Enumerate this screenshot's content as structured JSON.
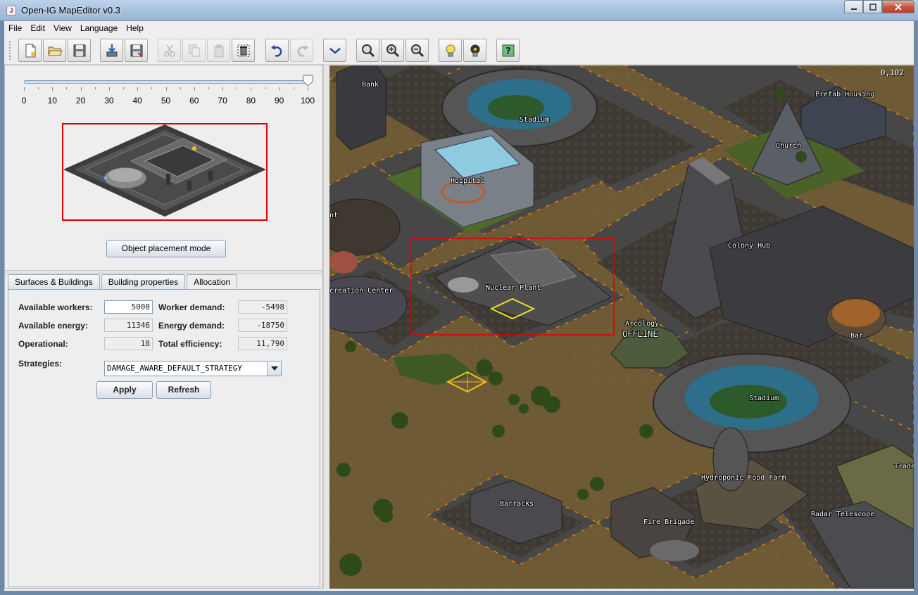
{
  "window": {
    "title": "Open-IG MapEditor v0.3",
    "app_icon": "java-cup-icon"
  },
  "menu": [
    "File",
    "Edit",
    "View",
    "Language",
    "Help"
  ],
  "toolbar": {
    "buttons": [
      {
        "name": "new-map-button",
        "icon": "new-document-icon",
        "enabled": true
      },
      {
        "name": "open-button",
        "icon": "open-folder-icon",
        "enabled": true
      },
      {
        "name": "save-button",
        "icon": "floppy-disk-icon",
        "enabled": true
      },
      {
        "name": "import-button",
        "icon": "import-download-icon",
        "enabled": true
      },
      {
        "name": "save-as-button",
        "icon": "save-as-icon",
        "enabled": true
      },
      {
        "name": "cut-button",
        "icon": "scissors-icon",
        "enabled": false
      },
      {
        "name": "copy-button",
        "icon": "copy-icon",
        "enabled": false
      },
      {
        "name": "paste-button",
        "icon": "paste-icon",
        "enabled": false
      },
      {
        "name": "delete-button",
        "icon": "delete-selection-icon",
        "enabled": true
      },
      {
        "name": "undo-button",
        "icon": "undo-icon",
        "enabled": true
      },
      {
        "name": "redo-button",
        "icon": "redo-icon",
        "enabled": false
      },
      {
        "name": "view-dropdown-button",
        "icon": "chevron-down-icon",
        "enabled": true
      },
      {
        "name": "zoom-normal-button",
        "icon": "magnifier-icon",
        "enabled": true
      },
      {
        "name": "zoom-in-button",
        "icon": "zoom-in-icon",
        "enabled": true
      },
      {
        "name": "zoom-out-button",
        "icon": "zoom-out-icon",
        "enabled": true
      },
      {
        "name": "lights-on-button",
        "icon": "light-bulb-on-icon",
        "enabled": true
      },
      {
        "name": "lights-off-button",
        "icon": "light-bulb-off-icon",
        "enabled": true
      },
      {
        "name": "help-button",
        "icon": "question-mark-icon",
        "enabled": true
      }
    ]
  },
  "slider": {
    "value": 100,
    "min": 0,
    "max": 100,
    "labels": [
      "0",
      "10",
      "20",
      "30",
      "40",
      "50",
      "60",
      "70",
      "80",
      "90",
      "100"
    ]
  },
  "preview": {
    "building": "Nuclear Plant"
  },
  "mode_button": "Object placement mode",
  "tabs": [
    {
      "label": "Surfaces & Buildings",
      "active": false
    },
    {
      "label": "Building properties",
      "active": false
    },
    {
      "label": "Allocation",
      "active": true
    }
  ],
  "allocation": {
    "available_workers": {
      "label": "Available workers:",
      "value": "5000"
    },
    "worker_demand": {
      "label": "Worker demand:",
      "value": "-5498"
    },
    "available_energy": {
      "label": "Available energy:",
      "value": "11346"
    },
    "energy_demand": {
      "label": "Energy demand:",
      "value": "-18750"
    },
    "operational": {
      "label": "Operational:",
      "value": "18"
    },
    "total_efficiency": {
      "label": "Total efficiency:",
      "value": "11,790"
    },
    "strategies": {
      "label": "Strategies:",
      "value": "DAMAGE_AWARE_DEFAULT_STRATEGY"
    },
    "apply": "Apply",
    "refresh": "Refresh"
  },
  "map": {
    "coordinate": "0,102",
    "buildings": [
      "Bank",
      "Stadium",
      "Prefab Housing",
      "Church",
      "Hospital",
      "nt",
      "Colony Hub",
      "creation Center",
      "Nuclear Plant",
      "Arcology",
      "OFFLINE",
      "Bar",
      "Stadium",
      "Hydroponic Food Farm",
      "Traders",
      "Barracks",
      "Fire Brigade",
      "Radar Telescope"
    ]
  },
  "colors": {
    "selection": "#e00000",
    "accent": "#f0c020",
    "terrain": "#6e5a34",
    "road": "#474747"
  }
}
